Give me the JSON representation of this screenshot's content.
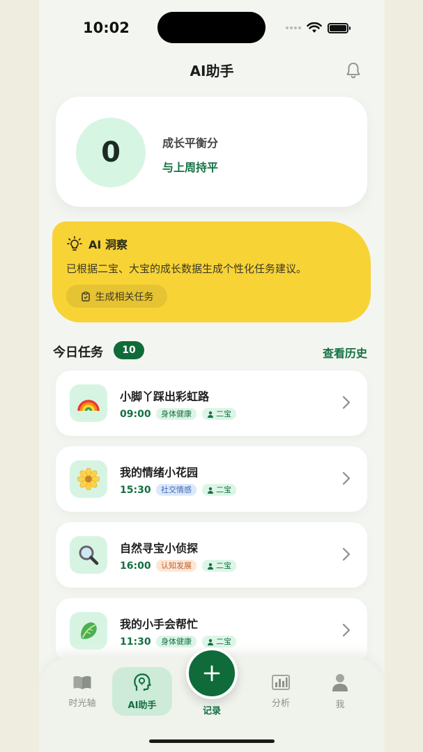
{
  "status_bar": {
    "time": "10:02"
  },
  "header": {
    "title": "AI助手"
  },
  "score_card": {
    "score": "0",
    "label": "成长平衡分",
    "compare": "与上周持平"
  },
  "insight": {
    "title": "AI 洞察",
    "text": "已根据二宝、大宝的成长数据生成个性化任务建议。",
    "button_label": "生成相关任务"
  },
  "tasks": {
    "title": "今日任务",
    "count": "10",
    "history_label": "查看历史",
    "items": [
      {
        "icon": "rainbow",
        "title": "小脚丫踩出彩虹路",
        "time": "09:00",
        "category": "身体健康",
        "category_type": "health",
        "child": "二宝"
      },
      {
        "icon": "flower",
        "title": "我的情绪小花园",
        "time": "15:30",
        "category": "社交情感",
        "category_type": "social",
        "child": "二宝"
      },
      {
        "icon": "magnifier",
        "title": "自然寻宝小侦探",
        "time": "16:00",
        "category": "认知发展",
        "category_type": "cognitive",
        "child": "二宝"
      },
      {
        "icon": "lettuce",
        "title": "我的小手会帮忙",
        "time": "11:30",
        "category": "身体健康",
        "category_type": "health",
        "child": "二宝"
      }
    ]
  },
  "bottom_nav": {
    "items": [
      {
        "label": "时光轴",
        "icon": "book-icon"
      },
      {
        "label": "AI助手",
        "icon": "ai-head-icon",
        "active": true
      },
      {
        "label": "记录",
        "icon": "plus-icon"
      },
      {
        "label": "分析",
        "icon": "bar-chart-icon"
      },
      {
        "label": "我",
        "icon": "person-icon"
      }
    ]
  },
  "colors": {
    "accent": "#137042",
    "insight_bg": "#f7d336",
    "score_bg": "#d6f5e3"
  }
}
